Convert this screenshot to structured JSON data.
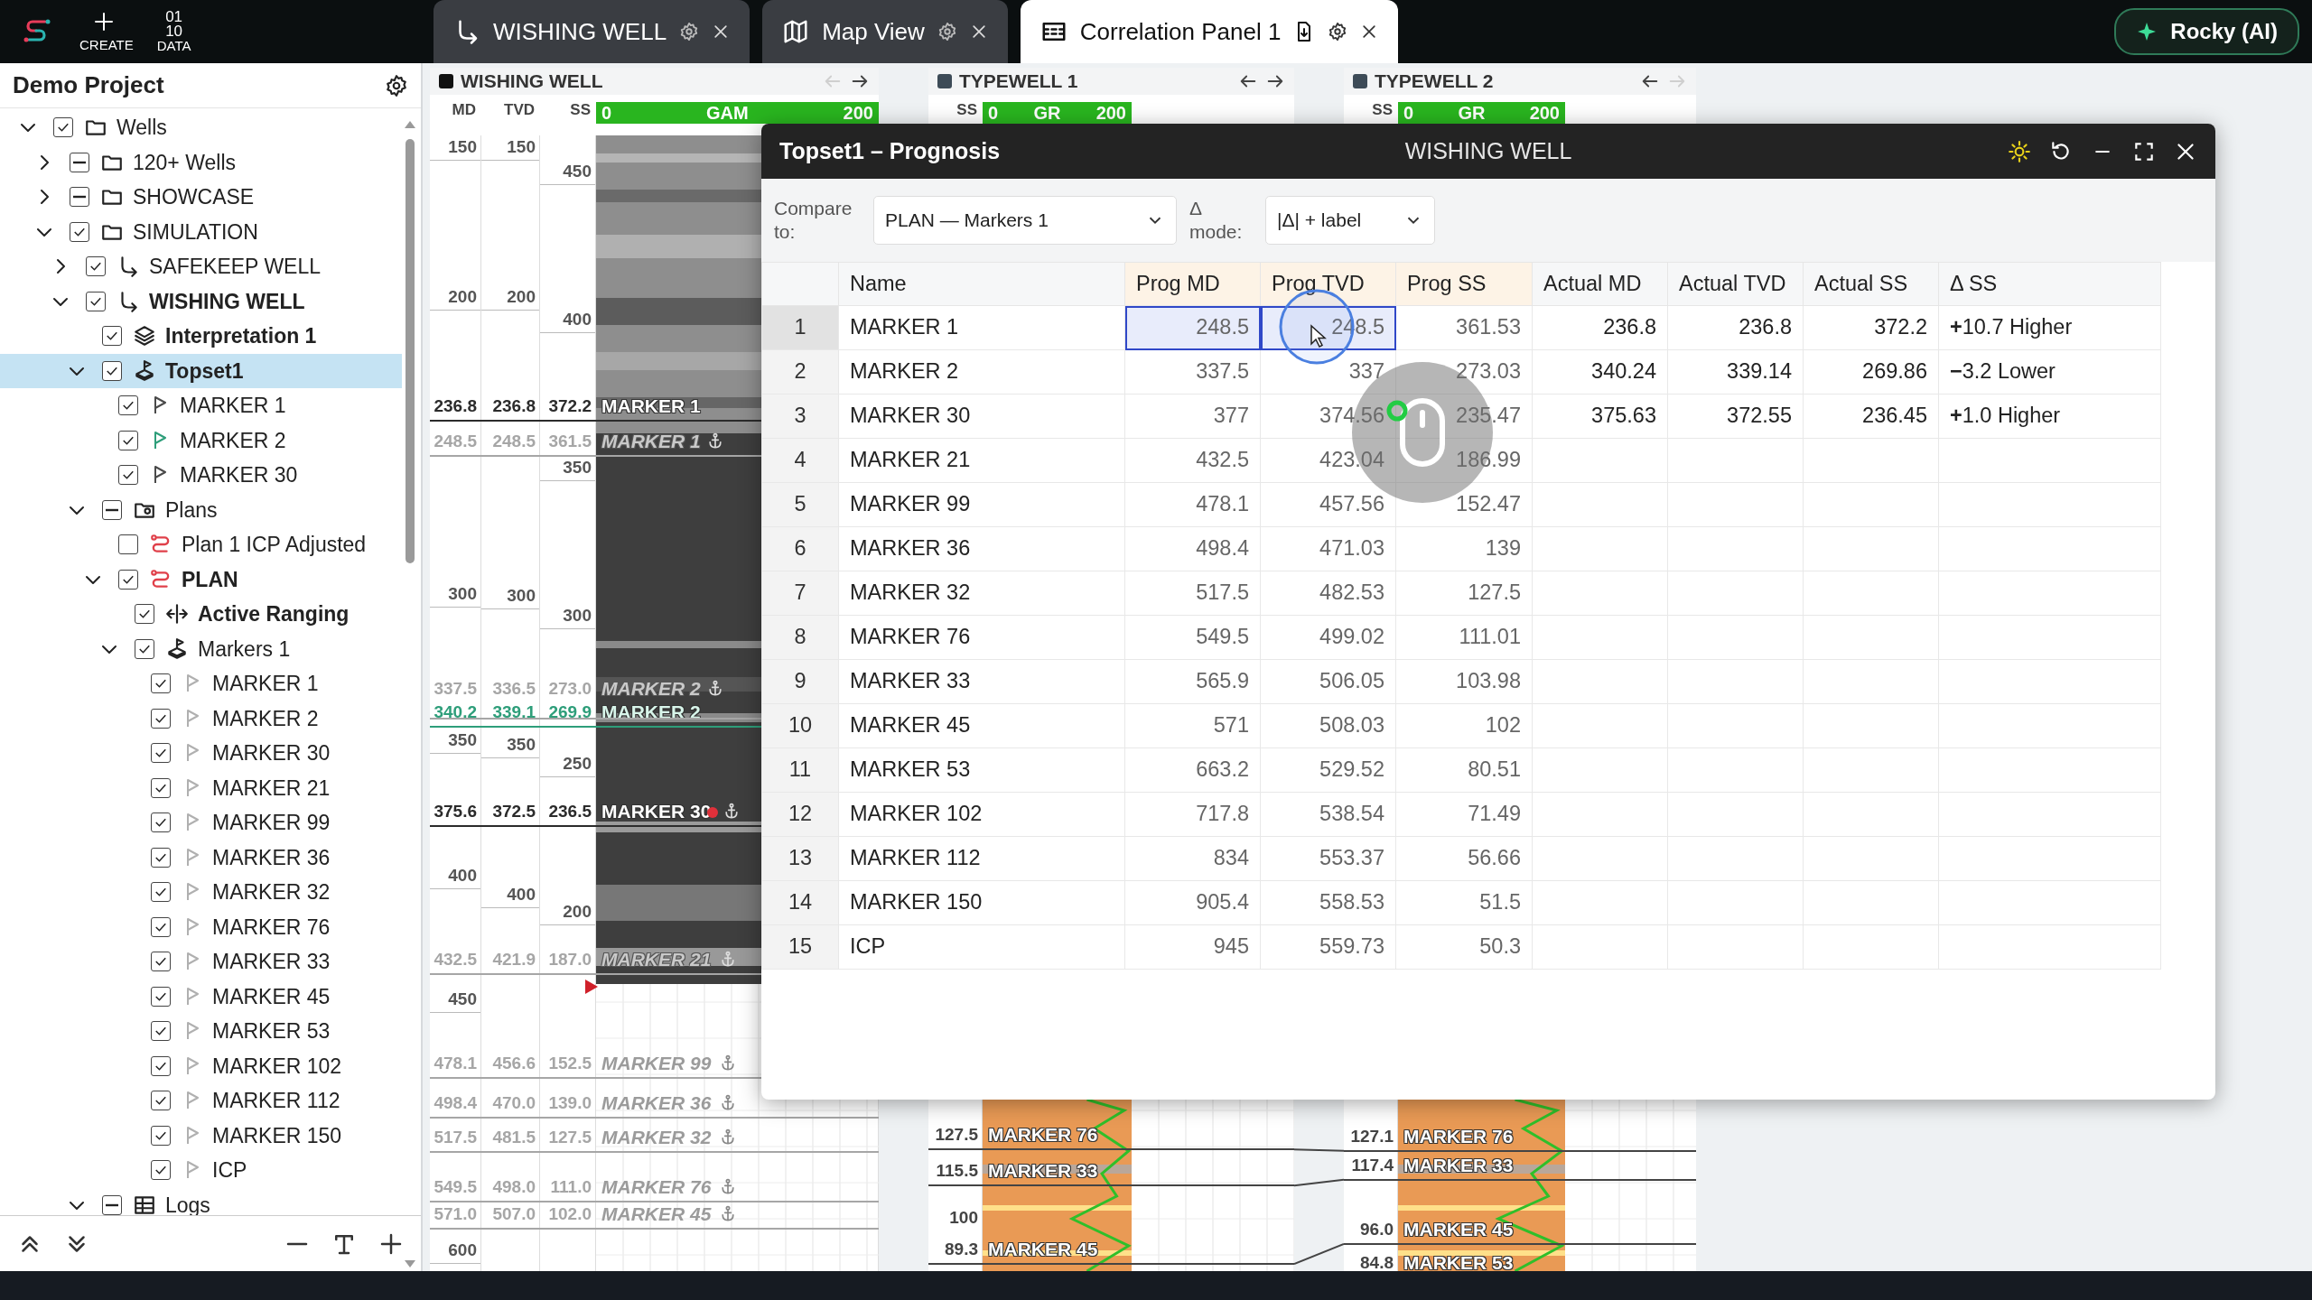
{
  "app_bar": {
    "create_label": "CREATE",
    "data_label": "DATA",
    "data_icon_lines": [
      "01",
      "10"
    ]
  },
  "tabs": [
    {
      "label": "WISHING WELL",
      "kind": "well",
      "selected": false,
      "export": false
    },
    {
      "label": "Map View",
      "kind": "map",
      "selected": false,
      "export": false
    },
    {
      "label": "Correlation Panel 1",
      "kind": "panel",
      "selected": true,
      "export": true
    }
  ],
  "assistant_button": {
    "label": "Rocky (AI)"
  },
  "project": {
    "title": "Demo Project",
    "tree": [
      {
        "label": "Wells",
        "kind": "folder",
        "checked": true,
        "mixed": false,
        "expanded": true,
        "bold": false,
        "selected": false,
        "children": [
          {
            "label": "120+ Wells",
            "kind": "folder",
            "checked": true,
            "mixed": true,
            "expanded": false,
            "bold": false,
            "selected": false
          },
          {
            "label": "SHOWCASE",
            "kind": "folder",
            "checked": true,
            "mixed": true,
            "expanded": false,
            "bold": false,
            "selected": false
          },
          {
            "label": "SIMULATION",
            "kind": "folder",
            "checked": true,
            "mixed": false,
            "expanded": true,
            "bold": false,
            "selected": false,
            "children": [
              {
                "label": "SAFEKEEP WELL",
                "kind": "well",
                "checked": true,
                "mixed": false,
                "expanded": false,
                "bold": false,
                "selected": false
              },
              {
                "label": "WISHING WELL",
                "kind": "well",
                "checked": true,
                "mixed": false,
                "expanded": true,
                "bold": true,
                "selected": false,
                "children": [
                  {
                    "label": "Interpretation 1",
                    "kind": "layers",
                    "checked": true,
                    "mixed": false,
                    "bold": true,
                    "selected": false
                  },
                  {
                    "label": "Topset1",
                    "kind": "topset",
                    "checked": true,
                    "mixed": false,
                    "expanded": true,
                    "bold": true,
                    "selected": true,
                    "children": [
                      {
                        "label": "MARKER 1",
                        "kind": "flag",
                        "color": "#4a4a4a",
                        "checked": true,
                        "mixed": false,
                        "bold": false,
                        "selected": false
                      },
                      {
                        "label": "MARKER 2",
                        "kind": "flag",
                        "color": "#2e9e7a",
                        "checked": true,
                        "mixed": false,
                        "bold": false,
                        "selected": false
                      },
                      {
                        "label": "MARKER 30",
                        "kind": "flag",
                        "color": "#4a4a4a",
                        "checked": true,
                        "mixed": false,
                        "bold": false,
                        "selected": false
                      }
                    ]
                  },
                  {
                    "label": "Plans",
                    "kind": "plans",
                    "checked": true,
                    "mixed": true,
                    "expanded": true,
                    "bold": false,
                    "selected": false,
                    "children": [
                      {
                        "label": "Plan 1 ICP Adjusted",
                        "kind": "plan",
                        "checked": false,
                        "mixed": false,
                        "bold": false,
                        "selected": false
                      },
                      {
                        "label": "PLAN",
                        "kind": "plan",
                        "checked": true,
                        "mixed": false,
                        "expanded": true,
                        "bold": true,
                        "selected": false,
                        "children": [
                          {
                            "label": "Active Ranging",
                            "kind": "ranging",
                            "checked": true,
                            "mixed": false,
                            "bold": true,
                            "selected": false
                          },
                          {
                            "label": "Markers 1",
                            "kind": "topset",
                            "checked": true,
                            "mixed": false,
                            "expanded": true,
                            "bold": false,
                            "selected": false,
                            "children": [
                              {
                                "label": "MARKER 1",
                                "kind": "flag",
                                "color": "#b0b0b0",
                                "checked": true,
                                "mixed": false,
                                "bold": false,
                                "selected": false
                              },
                              {
                                "label": "MARKER 2",
                                "kind": "flag",
                                "color": "#b0b0b0",
                                "checked": true,
                                "mixed": false,
                                "bold": false,
                                "selected": false
                              },
                              {
                                "label": "MARKER 30",
                                "kind": "flag",
                                "color": "#b0b0b0",
                                "checked": true,
                                "mixed": false,
                                "bold": false,
                                "selected": false
                              },
                              {
                                "label": "MARKER 21",
                                "kind": "flag",
                                "color": "#b0b0b0",
                                "checked": true,
                                "mixed": false,
                                "bold": false,
                                "selected": false
                              },
                              {
                                "label": "MARKER 99",
                                "kind": "flag",
                                "color": "#b0b0b0",
                                "checked": true,
                                "mixed": false,
                                "bold": false,
                                "selected": false
                              },
                              {
                                "label": "MARKER 36",
                                "kind": "flag",
                                "color": "#b0b0b0",
                                "checked": true,
                                "mixed": false,
                                "bold": false,
                                "selected": false
                              },
                              {
                                "label": "MARKER 32",
                                "kind": "flag",
                                "color": "#b0b0b0",
                                "checked": true,
                                "mixed": false,
                                "bold": false,
                                "selected": false
                              },
                              {
                                "label": "MARKER 76",
                                "kind": "flag",
                                "color": "#b0b0b0",
                                "checked": true,
                                "mixed": false,
                                "bold": false,
                                "selected": false
                              },
                              {
                                "label": "MARKER 33",
                                "kind": "flag",
                                "color": "#b0b0b0",
                                "checked": true,
                                "mixed": false,
                                "bold": false,
                                "selected": false
                              },
                              {
                                "label": "MARKER 45",
                                "kind": "flag",
                                "color": "#b0b0b0",
                                "checked": true,
                                "mixed": false,
                                "bold": false,
                                "selected": false
                              },
                              {
                                "label": "MARKER 53",
                                "kind": "flag",
                                "color": "#b0b0b0",
                                "checked": true,
                                "mixed": false,
                                "bold": false,
                                "selected": false
                              },
                              {
                                "label": "MARKER 102",
                                "kind": "flag",
                                "color": "#b0b0b0",
                                "checked": true,
                                "mixed": false,
                                "bold": false,
                                "selected": false
                              },
                              {
                                "label": "MARKER 112",
                                "kind": "flag",
                                "color": "#b0b0b0",
                                "checked": true,
                                "mixed": false,
                                "bold": false,
                                "selected": false
                              },
                              {
                                "label": "MARKER 150",
                                "kind": "flag",
                                "color": "#b0b0b0",
                                "checked": true,
                                "mixed": false,
                                "bold": false,
                                "selected": false
                              },
                              {
                                "label": "ICP",
                                "kind": "flag",
                                "color": "#b0b0b0",
                                "checked": true,
                                "mixed": false,
                                "bold": false,
                                "selected": false
                              }
                            ]
                          }
                        ]
                      }
                    ]
                  },
                  {
                    "label": "Logs",
                    "kind": "table",
                    "checked": true,
                    "mixed": true,
                    "expanded": true,
                    "bold": false,
                    "selected": false
                  }
                ]
              }
            ]
          }
        ]
      }
    ]
  },
  "tracks": [
    {
      "kind": "well",
      "title": "WISHING WELL",
      "color": "#111111",
      "back_enabled": false,
      "forward_enabled": true,
      "columns": [
        "MD",
        "TVD",
        "SS"
      ],
      "log": {
        "min": "0",
        "name": "GAM",
        "max": "200"
      },
      "md_ticks": [
        "150",
        "200",
        "300",
        "350",
        "400",
        "450",
        "600"
      ],
      "tvd_ticks": [
        "150",
        "200",
        "300",
        "350",
        "400"
      ],
      "ss_ticks": [
        "450",
        "400",
        "350",
        "300",
        "250",
        "200"
      ],
      "markers": [
        {
          "kind": "actual",
          "md": "236.8",
          "tvd": "236.8",
          "ss": "372.2",
          "name": "MARKER 1",
          "color": "#2b2b2b"
        },
        {
          "kind": "prog",
          "md": "248.5",
          "tvd": "248.5",
          "ss": "361.5",
          "name": "MARKER 1",
          "color": "#a6a6a6",
          "anchor": true
        },
        {
          "kind": "prog",
          "md": "337.5",
          "tvd": "336.5",
          "ss": "273.0",
          "name": "MARKER 2",
          "color": "#a6a6a6",
          "anchor": true
        },
        {
          "kind": "actual",
          "md": "340.2",
          "tvd": "339.1",
          "ss": "269.9",
          "name": "MARKER 2",
          "color": "#2e9e7a"
        },
        {
          "kind": "actual",
          "md": "375.6",
          "tvd": "372.5",
          "ss": "236.5",
          "name": "MARKER 30",
          "color": "#2b2b2b",
          "anchor": true,
          "pin": true
        },
        {
          "kind": "prog",
          "md": "432.5",
          "tvd": "421.9",
          "ss": "187.0",
          "name": "MARKER 21",
          "color": "#a6a6a6",
          "anchor": true
        },
        {
          "kind": "prog",
          "md": "478.1",
          "tvd": "456.6",
          "ss": "152.5",
          "name": "MARKER 99",
          "color": "#a6a6a6",
          "anchor": true
        },
        {
          "kind": "prog",
          "md": "498.4",
          "tvd": "470.0",
          "ss": "139.0",
          "name": "MARKER 36",
          "color": "#a6a6a6",
          "anchor": true
        },
        {
          "kind": "prog",
          "md": "517.5",
          "tvd": "481.5",
          "ss": "127.5",
          "name": "MARKER 32",
          "color": "#a6a6a6",
          "anchor": true
        },
        {
          "kind": "prog",
          "md": "549.5",
          "tvd": "498.0",
          "ss": "111.0",
          "name": "MARKER 76",
          "color": "#a6a6a6",
          "anchor": true
        },
        {
          "kind": "prog",
          "md": "571.0",
          "tvd": "507.0",
          "ss": "102.0",
          "name": "MARKER 45",
          "color": "#a6a6a6",
          "anchor": true
        }
      ]
    },
    {
      "kind": "typewell",
      "title": "TYPEWELL 1",
      "color": "#3d4b57",
      "back_enabled": true,
      "forward_enabled": true,
      "columns": [
        "SS"
      ],
      "log": {
        "min": "0",
        "name": "GR",
        "max": "200"
      },
      "ss_ticks": [
        "100"
      ],
      "markers": [
        {
          "ss": "127.5",
          "name": "MARKER 76"
        },
        {
          "ss": "115.5",
          "name": "MARKER 33"
        },
        {
          "ss": "89.3",
          "name": "MARKER 45"
        }
      ]
    },
    {
      "kind": "typewell",
      "title": "TYPEWELL 2",
      "color": "#3d4b57",
      "back_enabled": true,
      "forward_enabled": false,
      "columns": [
        "SS"
      ],
      "log": {
        "min": "0",
        "name": "GR",
        "max": "200"
      },
      "markers": [
        {
          "ss": "127.1",
          "name": "MARKER 76"
        },
        {
          "ss": "117.4",
          "name": "MARKER 33"
        },
        {
          "ss": "96.0",
          "name": "MARKER 45"
        },
        {
          "ss": "84.8",
          "name": "MARKER 53"
        }
      ]
    }
  ],
  "dialog": {
    "title": "Topset1 – Prognosis",
    "subtitle": "WISHING WELL",
    "compare_label": "Compare to:",
    "compare_value": "PLAN — Markers 1",
    "mode_label": "Δ mode:",
    "mode_value": "|Δ| + label",
    "columns": [
      {
        "label": "Name",
        "kind": "name",
        "selected": false
      },
      {
        "label": "Prog MD",
        "kind": "prog",
        "selected": true
      },
      {
        "label": "Prog TVD",
        "kind": "prog",
        "selected": true
      },
      {
        "label": "Prog SS",
        "kind": "prog",
        "selected": false
      },
      {
        "label": "Actual MD",
        "kind": "actual",
        "selected": false
      },
      {
        "label": "Actual TVD",
        "kind": "actual",
        "selected": false
      },
      {
        "label": "Actual SS",
        "kind": "actual",
        "selected": false
      },
      {
        "label": "Δ SS",
        "kind": "delta",
        "selected": false
      }
    ],
    "rows": [
      {
        "index": "1",
        "selected": true,
        "cells": [
          "MARKER 1",
          "248.5",
          "248.5",
          "361.53",
          "236.8",
          "236.8",
          "372.2",
          "**+**10.7 Higher"
        ]
      },
      {
        "index": "2",
        "selected": false,
        "cells": [
          "MARKER 2",
          "337.5",
          "337",
          "273.03",
          "340.24",
          "339.14",
          "269.86",
          "**−**3.2 Lower"
        ]
      },
      {
        "index": "3",
        "selected": false,
        "cells": [
          "MARKER 30",
          "377",
          "374.56",
          "235.47",
          "375.63",
          "372.55",
          "236.45",
          "**+**1.0 Higher"
        ]
      },
      {
        "index": "4",
        "selected": false,
        "cells": [
          "MARKER 21",
          "432.5",
          "423.04",
          "186.99"
        ]
      },
      {
        "index": "5",
        "selected": false,
        "cells": [
          "MARKER 99",
          "478.1",
          "457.56",
          "152.47"
        ]
      },
      {
        "index": "6",
        "selected": false,
        "cells": [
          "MARKER 36",
          "498.4",
          "471.03",
          "139"
        ]
      },
      {
        "index": "7",
        "selected": false,
        "cells": [
          "MARKER 32",
          "517.5",
          "482.53",
          "127.5"
        ]
      },
      {
        "index": "8",
        "selected": false,
        "cells": [
          "MARKER 76",
          "549.5",
          "499.02",
          "111.01"
        ]
      },
      {
        "index": "9",
        "selected": false,
        "cells": [
          "MARKER 33",
          "565.9",
          "506.05",
          "103.98"
        ]
      },
      {
        "index": "10",
        "selected": false,
        "cells": [
          "MARKER 45",
          "571",
          "508.03",
          "102"
        ]
      },
      {
        "index": "11",
        "selected": false,
        "cells": [
          "MARKER 53",
          "663.2",
          "529.52",
          "80.51"
        ]
      },
      {
        "index": "12",
        "selected": false,
        "cells": [
          "MARKER 102",
          "717.8",
          "538.54",
          "71.49"
        ]
      },
      {
        "index": "13",
        "selected": false,
        "cells": [
          "MARKER 112",
          "834",
          "553.37",
          "56.66"
        ]
      },
      {
        "index": "14",
        "selected": false,
        "cells": [
          "MARKER 150",
          "905.4",
          "558.53",
          "51.5"
        ]
      },
      {
        "index": "15",
        "selected": false,
        "cells": [
          "ICP",
          "945",
          "559.73",
          "50.3"
        ]
      }
    ]
  }
}
